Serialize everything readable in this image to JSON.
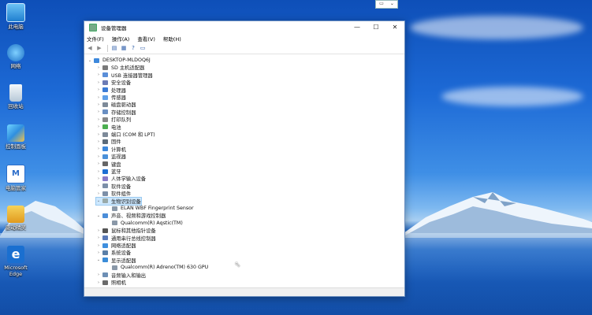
{
  "desktop": {
    "icons": [
      {
        "label": "此电脑",
        "icon": "computer-icon"
      },
      {
        "label": "网络",
        "icon": "network-icon"
      },
      {
        "label": "回收站",
        "icon": "recycle-bin-icon"
      },
      {
        "label": "控制面板",
        "icon": "control-panel-icon"
      },
      {
        "label": "电脑管家",
        "icon": "pc-manager-icon"
      },
      {
        "label": "驱动精灵",
        "icon": "driver-icon"
      },
      {
        "label": "Microsoft Edge",
        "icon": "edge-icon"
      }
    ]
  },
  "window": {
    "title": "设备管理器",
    "controls": {
      "minimize": "—",
      "maximize": "☐",
      "close": "✕"
    },
    "menu": [
      "文件(F)",
      "操作(A)",
      "查看(V)",
      "帮助(H)"
    ],
    "tree": {
      "root": "DESKTOP-MLDOQ6J",
      "items": [
        {
          "label": "SD 主机适配器",
          "icon": "sd-icon",
          "expanded": false
        },
        {
          "label": "USB 连接器管理器",
          "icon": "usb-icon",
          "expanded": false
        },
        {
          "label": "安全设备",
          "icon": "security-icon",
          "expanded": false
        },
        {
          "label": "处理器",
          "icon": "cpu-icon",
          "expanded": false
        },
        {
          "label": "传感器",
          "icon": "sensor-icon",
          "expanded": false
        },
        {
          "label": "磁盘驱动器",
          "icon": "disk-icon",
          "expanded": false
        },
        {
          "label": "存储控制器",
          "icon": "storage-icon",
          "expanded": false
        },
        {
          "label": "打印队列",
          "icon": "printer-icon",
          "expanded": false
        },
        {
          "label": "电池",
          "icon": "battery-icon",
          "expanded": false
        },
        {
          "label": "端口 (COM 和 LPT)",
          "icon": "port-icon",
          "expanded": false
        },
        {
          "label": "固件",
          "icon": "firmware-icon",
          "expanded": false
        },
        {
          "label": "计算机",
          "icon": "computer-icon",
          "expanded": false
        },
        {
          "label": "监视器",
          "icon": "monitor-icon",
          "expanded": false
        },
        {
          "label": "键盘",
          "icon": "keyboard-icon",
          "expanded": false
        },
        {
          "label": "蓝牙",
          "icon": "bluetooth-icon",
          "expanded": false
        },
        {
          "label": "人体学输入设备",
          "icon": "hid-icon",
          "expanded": false
        },
        {
          "label": "软件设备",
          "icon": "software-device-icon",
          "expanded": false
        },
        {
          "label": "软件组件",
          "icon": "software-component-icon",
          "expanded": false
        },
        {
          "label": "生物识别设备",
          "icon": "biometric-icon",
          "expanded": true,
          "selected": true,
          "children": [
            "ELAN WBF Fingerprint Sensor"
          ]
        },
        {
          "label": "声音、视频和游戏控制器",
          "icon": "sound-icon",
          "expanded": true,
          "children": [
            "Qualcomm(R) Aqstic(TM)"
          ]
        },
        {
          "label": "鼠标和其他指针设备",
          "icon": "mouse-icon",
          "expanded": false
        },
        {
          "label": "通用串行总线控制器",
          "icon": "usb-controller-icon",
          "expanded": false
        },
        {
          "label": "网络适配器",
          "icon": "network-adapter-icon",
          "expanded": false
        },
        {
          "label": "系统设备",
          "icon": "system-device-icon",
          "expanded": false
        },
        {
          "label": "显示适配器",
          "icon": "display-adapter-icon",
          "expanded": true,
          "children": [
            "Qualcomm(R) Adreno(TM) 630 GPU"
          ]
        },
        {
          "label": "音频输入和输出",
          "icon": "audio-io-icon",
          "expanded": false
        },
        {
          "label": "照相机",
          "icon": "camera-icon",
          "expanded": false
        }
      ]
    }
  },
  "colors": {
    "selection": "#cde8ff",
    "window_border": "#6b8fbf"
  }
}
